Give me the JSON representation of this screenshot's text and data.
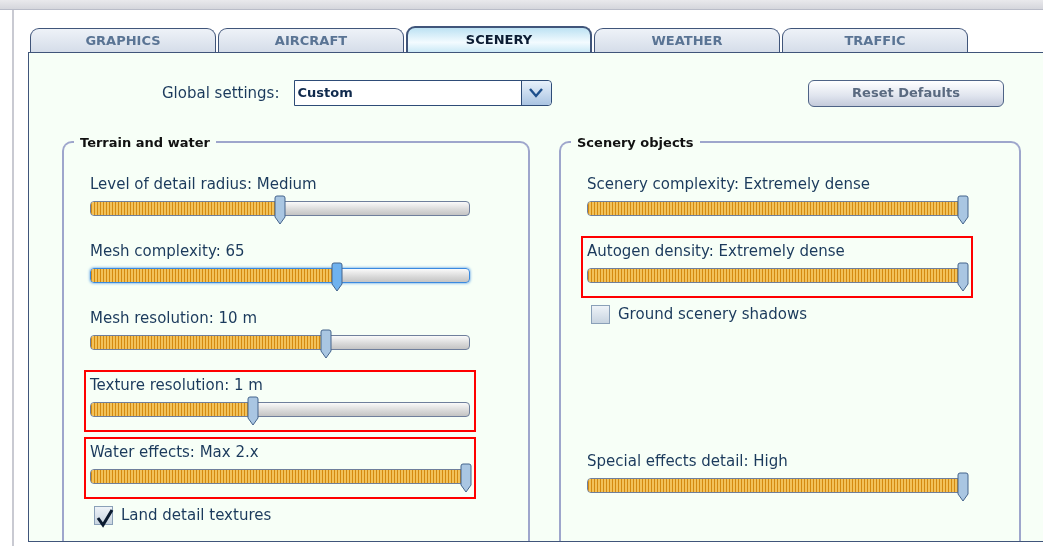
{
  "tabs": [
    {
      "label": "GRAPHICS",
      "selected": false
    },
    {
      "label": "AIRCRAFT",
      "selected": false
    },
    {
      "label": "SCENERY",
      "selected": true
    },
    {
      "label": "WEATHER",
      "selected": false
    },
    {
      "label": "TRAFFIC",
      "selected": false
    }
  ],
  "global_settings": {
    "label": "Global settings:",
    "value": "Custom"
  },
  "reset_button": "Reset Defaults",
  "terrain_and_water": {
    "title": "Terrain and water",
    "items": [
      {
        "kind": "slider",
        "label": "Level of detail radius: Medium",
        "level": 0.5,
        "focused": false,
        "highlighted": false
      },
      {
        "kind": "slider",
        "label": "Mesh complexity: 65",
        "level": 0.65,
        "focused": true,
        "highlighted": false
      },
      {
        "kind": "slider",
        "label": "Mesh resolution: 10 m",
        "level": 0.62,
        "focused": false,
        "highlighted": false
      },
      {
        "kind": "slider",
        "label": "Texture resolution: 1 m",
        "level": 0.43,
        "focused": false,
        "highlighted": true
      },
      {
        "kind": "slider",
        "label": "Water effects: Max 2.x",
        "level": 1,
        "focused": false,
        "highlighted": true
      },
      {
        "kind": "checkbox",
        "label": "Land detail textures",
        "checked": true
      }
    ]
  },
  "scenery_objects": {
    "title": "Scenery objects",
    "items": [
      {
        "kind": "slider",
        "label": "Scenery complexity: Extremely dense",
        "level": 1,
        "focused": false,
        "highlighted": false
      },
      {
        "kind": "slider",
        "label": "Autogen density: Extremely dense",
        "level": 1,
        "focused": false,
        "highlighted": true
      },
      {
        "kind": "checkbox",
        "label": "Ground scenery shadows",
        "checked": false
      }
    ],
    "bottom_items": [
      {
        "kind": "slider",
        "label": "Special effects detail: High",
        "level": 1,
        "focused": false,
        "highlighted": false
      }
    ]
  }
}
